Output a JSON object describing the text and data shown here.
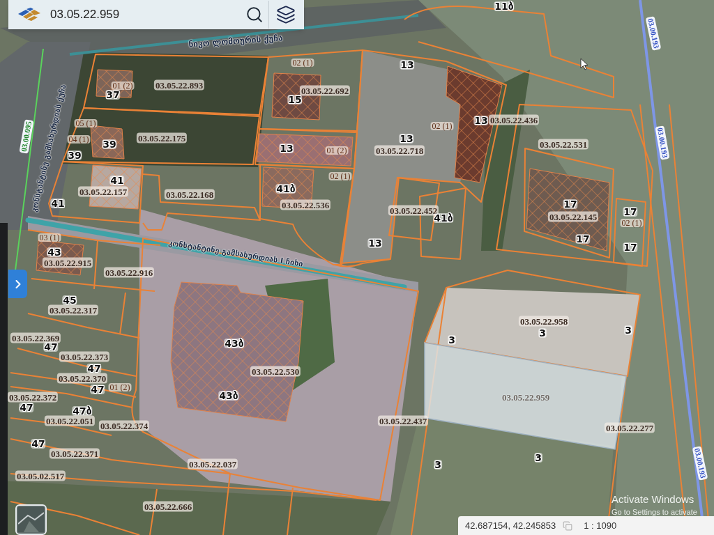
{
  "search_bar": {
    "value": "03.05.22.959"
  },
  "side_panel_toggle": {
    "expanded": false
  },
  "map": {
    "street_labels": [
      {
        "text": "ნიკო ლომოურის ქუჩა"
      },
      {
        "text": "კონსტანტინე გამსახურდიას ქუჩა"
      },
      {
        "text": "კონსტანტინე გამსახურდიას I ჩიხი"
      }
    ],
    "road_codes": [
      {
        "text": "03.00.193",
        "color": "#3552c4"
      },
      {
        "text": "03.00.095",
        "color": "#24872f"
      },
      {
        "text": "03.00.193",
        "color": "#3552c4"
      },
      {
        "text": "03.00.193",
        "color": "#3552c4"
      }
    ],
    "parcel_labels": [
      {
        "text": "11ბ",
        "kind": "number"
      },
      {
        "text": "02 (1)",
        "kind": "part"
      },
      {
        "text": "13",
        "kind": "number"
      },
      {
        "text": "01 (2)",
        "kind": "part"
      },
      {
        "text": "03.05.22.893",
        "kind": "code"
      },
      {
        "text": "37",
        "kind": "number"
      },
      {
        "text": "03.05.22.692",
        "kind": "code"
      },
      {
        "text": "15",
        "kind": "number"
      },
      {
        "text": "05 (1)",
        "kind": "part"
      },
      {
        "text": "02 (1)",
        "kind": "part"
      },
      {
        "text": "13",
        "kind": "number"
      },
      {
        "text": "03.05.22.436",
        "kind": "code"
      },
      {
        "text": "04 (1)",
        "kind": "part"
      },
      {
        "text": "39",
        "kind": "number"
      },
      {
        "text": "03.05.22.175",
        "kind": "code"
      },
      {
        "text": "13",
        "kind": "number"
      },
      {
        "text": "03.05.22.531",
        "kind": "code"
      },
      {
        "text": "39",
        "kind": "number"
      },
      {
        "text": "13",
        "kind": "number"
      },
      {
        "text": "01 (2)",
        "kind": "part"
      },
      {
        "text": "03.05.22.718",
        "kind": "code"
      },
      {
        "text": "41",
        "kind": "number"
      },
      {
        "text": "02 (1)",
        "kind": "part"
      },
      {
        "text": "03.05.22.157",
        "kind": "code"
      },
      {
        "text": "03.05.22.168",
        "kind": "code"
      },
      {
        "text": "41ბ",
        "kind": "number"
      },
      {
        "text": "41",
        "kind": "number"
      },
      {
        "text": "03.05.22.536",
        "kind": "code"
      },
      {
        "text": "03.05.22.452",
        "kind": "code"
      },
      {
        "text": "17",
        "kind": "number"
      },
      {
        "text": "17",
        "kind": "number"
      },
      {
        "text": "41ბ",
        "kind": "number"
      },
      {
        "text": "03.05.22.145",
        "kind": "code"
      },
      {
        "text": "02 (1)",
        "kind": "part"
      },
      {
        "text": "03 (1)",
        "kind": "part"
      },
      {
        "text": "13",
        "kind": "number"
      },
      {
        "text": "17",
        "kind": "number"
      },
      {
        "text": "17",
        "kind": "number"
      },
      {
        "text": "43",
        "kind": "number"
      },
      {
        "text": "03.05.22.915",
        "kind": "code"
      },
      {
        "text": "03.05.22.916",
        "kind": "code"
      },
      {
        "text": "45",
        "kind": "number"
      },
      {
        "text": "03.05.22.317",
        "kind": "code"
      },
      {
        "text": "03.05.22.958",
        "kind": "code"
      },
      {
        "text": "3",
        "kind": "number"
      },
      {
        "text": "3",
        "kind": "number"
      },
      {
        "text": "03.05.22.369",
        "kind": "code"
      },
      {
        "text": "43ბ",
        "kind": "number"
      },
      {
        "text": "3",
        "kind": "number"
      },
      {
        "text": "47",
        "kind": "number"
      },
      {
        "text": "03.05.22.373",
        "kind": "code"
      },
      {
        "text": "47",
        "kind": "number"
      },
      {
        "text": "03.05.22.530",
        "kind": "code"
      },
      {
        "text": "03.05.22.370",
        "kind": "code"
      },
      {
        "text": "47",
        "kind": "number"
      },
      {
        "text": "01 (2)",
        "kind": "part"
      },
      {
        "text": "03.05.22.372",
        "kind": "code"
      },
      {
        "text": "43ბ",
        "kind": "number"
      },
      {
        "text": "47",
        "kind": "number"
      },
      {
        "text": "47ბ",
        "kind": "number"
      },
      {
        "text": "03.05.22.051",
        "kind": "code"
      },
      {
        "text": "03.05.22.374",
        "kind": "code"
      },
      {
        "text": "03.05.22.437",
        "kind": "code"
      },
      {
        "text": "03.05.22.277",
        "kind": "code"
      },
      {
        "text": "47",
        "kind": "number"
      },
      {
        "text": "03.05.22.371",
        "kind": "code"
      },
      {
        "text": "3",
        "kind": "number"
      },
      {
        "text": "03.05.22.037",
        "kind": "code"
      },
      {
        "text": "3",
        "kind": "number"
      },
      {
        "text": "03.05.02.517",
        "kind": "code"
      },
      {
        "text": "03.05.22.666",
        "kind": "code"
      }
    ],
    "selected_parcel": {
      "label": "03.05.22.959"
    }
  },
  "status_bar": {
    "coordinates": "42.687154, 42.245853",
    "scale": "1 : 1090"
  },
  "system_notice": {
    "title": "Activate Windows",
    "subtitle": "Go to Settings to activate"
  }
}
